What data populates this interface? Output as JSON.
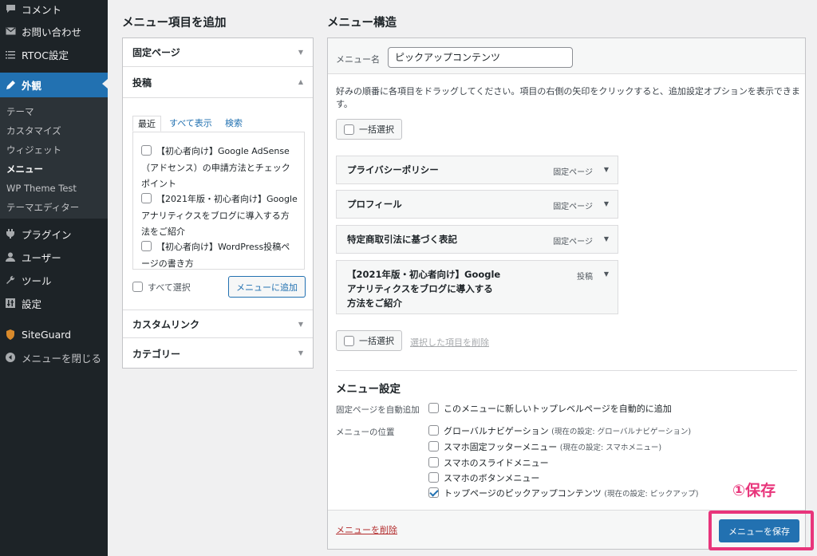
{
  "sidebar": {
    "items": [
      {
        "label": "コメント",
        "icon": "comment-icon"
      },
      {
        "label": "お問い合わせ",
        "icon": "mail-icon"
      },
      {
        "label": "RTOC設定",
        "icon": "list-icon"
      },
      {
        "label": "外観",
        "icon": "appearance-icon"
      },
      {
        "label": "プラグイン",
        "icon": "plugin-icon"
      },
      {
        "label": "ユーザー",
        "icon": "user-icon"
      },
      {
        "label": "ツール",
        "icon": "wrench-icon"
      },
      {
        "label": "設定",
        "icon": "settings-icon"
      },
      {
        "label": "SiteGuard",
        "icon": "siteguard-icon"
      },
      {
        "label": "メニューを閉じる",
        "icon": "collapse-icon"
      }
    ],
    "submenu": [
      "テーマ",
      "カスタマイズ",
      "ウィジェット",
      "メニュー",
      "WP Theme Test",
      "テーマエディター"
    ]
  },
  "left": {
    "heading": "メニュー項目を追加",
    "sections": {
      "pages": "固定ページ",
      "posts": "投稿",
      "custom_links": "カスタムリンク",
      "categories": "カテゴリー"
    },
    "tabs": [
      "最近",
      "すべて表示",
      "検索"
    ],
    "posts_lines": [
      "【初心者向け】Google AdSense",
      "（アドセンス）の申請方法とチェック",
      "ポイント",
      "【2021年版・初心者向け】Google",
      "アナリティクスをブログに導入する方",
      "法をご紹介",
      "【初心者向け】WordPress投稿ペ",
      "ージの書き方"
    ],
    "select_all": "すべて選択",
    "add_button": "メニューに追加"
  },
  "right": {
    "heading": "メニュー構造",
    "menu_name_label": "メニュー名",
    "menu_name_value": "ピックアップコンテンツ",
    "instructions": "好みの順番に各項目をドラッグしてください。項目の右側の矢印をクリックすると、追加設定オプションを表示できます。",
    "bulk_select": "一括選択",
    "items": [
      {
        "title": "プライバシーポリシー",
        "type": "固定ページ"
      },
      {
        "title": "プロフィール",
        "type": "固定ページ"
      },
      {
        "title": "特定商取引法に基づく表記",
        "type": "固定ページ"
      },
      {
        "title_lines": [
          "【2021年版・初心者向け】Google",
          "アナリティクスをブログに導入する",
          "方法をご紹介"
        ],
        "type": "投稿"
      }
    ],
    "delete_selected": "選択した項目を削除",
    "settings": {
      "heading": "メニュー設定",
      "auto_add_label": "固定ページを自動追加",
      "auto_add_option": "このメニューに新しいトップレベルページを自動的に追加",
      "locations_label": "メニューの位置",
      "locations": [
        {
          "name": "グローバルナビゲーション",
          "note": "(現在の設定: グローバルナビゲーション)",
          "checked": false
        },
        {
          "name": "スマホ固定フッターメニュー",
          "note": "(現在の設定: スマホメニュー)",
          "checked": false
        },
        {
          "name": "スマホのスライドメニュー",
          "note": "",
          "checked": false
        },
        {
          "name": "スマホのボタンメニュー",
          "note": "",
          "checked": false
        },
        {
          "name": "トップページのピックアップコンテンツ",
          "note": "(現在の設定: ピックアップ)",
          "checked": true
        }
      ]
    },
    "delete_menu": "メニューを削除",
    "save_button": "メニューを保存"
  },
  "annotation": {
    "callout": "①保存",
    "color": "#e8357b"
  },
  "colors": {
    "accent": "#2271b1",
    "sidebar": "#1d2327",
    "danger": "#b32d2e"
  }
}
